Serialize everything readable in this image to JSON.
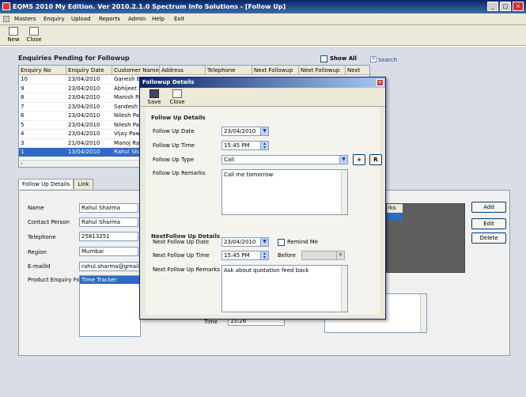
{
  "window": {
    "title": "EQMS 2010 My Edition. Ver 2010.2.1.0  Spectrum Info Solutions - [Follow Up]"
  },
  "menu": [
    "Masters",
    "Enquiry",
    "Upload",
    "Reports",
    "Admin",
    "Help",
    "Exit"
  ],
  "toolbar": {
    "new": "New",
    "close": "Close"
  },
  "pending": {
    "title": "Enquiries Pending for Followup",
    "show_all": "Show All",
    "search": "Search",
    "columns": [
      "Enquiry No",
      "Enquiry Date",
      "Customer Name",
      "Address",
      "Telephone",
      "Next Followup",
      "Next Followup",
      "Next"
    ],
    "rows": [
      {
        "no": "10",
        "date": "23/04/2010",
        "name": "Ganesh B"
      },
      {
        "no": "9",
        "date": "23/04/2010",
        "name": "Abhijeet P"
      },
      {
        "no": "8",
        "date": "23/04/2010",
        "name": "Manish Par"
      },
      {
        "no": "7",
        "date": "23/04/2010",
        "name": "Sandesh G"
      },
      {
        "no": "6",
        "date": "23/04/2010",
        "name": "Nilesh Patil"
      },
      {
        "no": "5",
        "date": "23/04/2010",
        "name": "Nilesh Patil"
      },
      {
        "no": "4",
        "date": "23/04/2010",
        "name": "Vijay Pawa"
      },
      {
        "no": "3",
        "date": "21/04/2010",
        "name": "Manoj Rah"
      },
      {
        "no": "1",
        "date": "13/04/2010",
        "name": "Rahul Shar"
      }
    ]
  },
  "tabs": [
    "Follow Up Details",
    "Link"
  ],
  "details": {
    "name_label": "Name",
    "name": "Rahul Sharma",
    "contact_label": "Contact Person",
    "contact": "Rahul Sharma",
    "telephone_label": "Telephone",
    "telephone": "25813251",
    "region_label": "Region",
    "region": "Mumbai",
    "email_label": "E-mailId",
    "email": "rahul.sharma@gmail.com",
    "product_label": "Product Enquiry For",
    "product": "Time Tracker",
    "time_label": "Time",
    "time": "15:26",
    "remarks_header": "rks"
  },
  "side_buttons": {
    "add": "Add",
    "edit": "Edit",
    "delete": "Delete"
  },
  "dialog": {
    "title": "Followup Details",
    "save": "Save",
    "close": "Close",
    "section1": "Follow Up Details",
    "date_label": "Follow Up Date",
    "date": "23/04/2010",
    "time_label": "Follow Up Time",
    "time": "15:45 PM",
    "type_label": "Follow Up Type",
    "type": "Call",
    "plus": "+",
    "r": "R",
    "remarks_label": "Follow Up Remarks",
    "remarks": "Call me tomorrow",
    "section2": "NextFollow Up Details",
    "next_date_label": "Next Follow Up Date",
    "next_date": "23/04/2010",
    "remind_label": "Remind Me",
    "next_time_label": "Next Follow Up Time",
    "next_time": "15:45 PM",
    "before_label": "Before",
    "next_remarks_label": "Next Follow Up Remarks",
    "next_remarks": "Ask about quotation feed back"
  }
}
